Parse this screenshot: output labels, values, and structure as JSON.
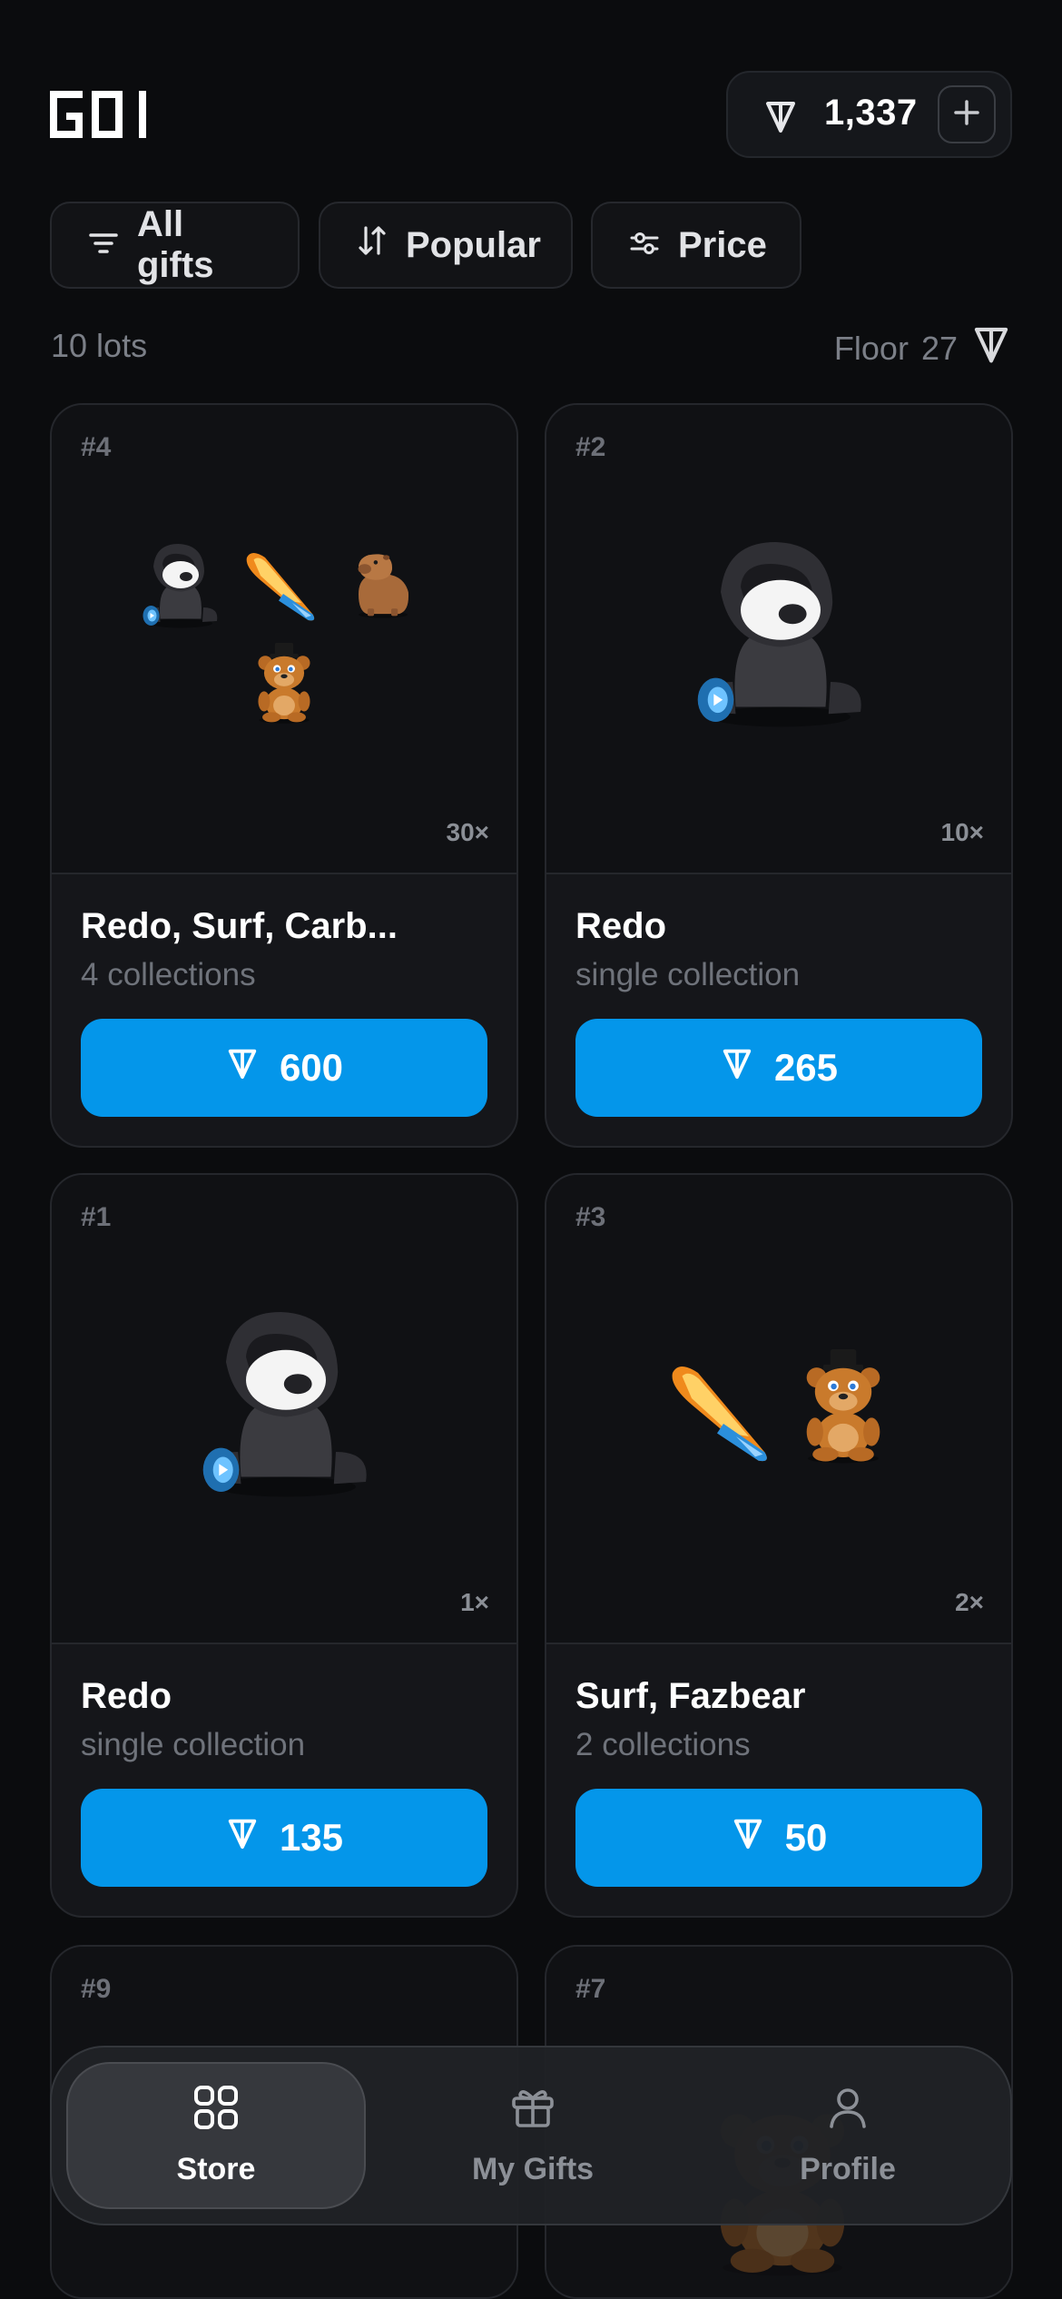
{
  "app": {
    "logo_text": "GOI"
  },
  "balance": {
    "amount": "1,337",
    "currency_icon": "ton-icon",
    "add_icon": "plus-icon"
  },
  "filters": [
    {
      "label": "All gifts",
      "icon": "filter-lines-icon"
    },
    {
      "label": "Popular",
      "icon": "sort-icon"
    },
    {
      "label": "Price",
      "icon": "sliders-icon"
    }
  ],
  "stats": {
    "lots": "10 lots",
    "floor_label": "Floor",
    "floor_value": "27"
  },
  "cards": [
    {
      "num": "#4",
      "count": "30×",
      "title": "Redo, Surf, Carb...",
      "sub": "4 collections",
      "price": "600",
      "gifts": [
        "redo",
        "surf",
        "capybara",
        "fazbear"
      ]
    },
    {
      "num": "#2",
      "count": "10×",
      "title": "Redo",
      "sub": "single collection",
      "price": "265",
      "gifts": [
        "redo"
      ]
    },
    {
      "num": "#1",
      "count": "1×",
      "title": "Redo",
      "sub": "single collection",
      "price": "135",
      "gifts": [
        "redo"
      ]
    },
    {
      "num": "#3",
      "count": "2×",
      "title": "Surf, Fazbear",
      "sub": "2 collections",
      "price": "50",
      "gifts": [
        "surf",
        "fazbear"
      ]
    },
    {
      "num": "#9"
    },
    {
      "num": "#7"
    }
  ],
  "nav": [
    {
      "label": "Store",
      "icon": "grid-icon",
      "active": true
    },
    {
      "label": "My Gifts",
      "icon": "gift-icon",
      "active": false
    },
    {
      "label": "Profile",
      "icon": "user-icon",
      "active": false
    }
  ],
  "colors": {
    "accent": "#0496ea",
    "background": "#0b0c0e",
    "card": "#15161a"
  }
}
